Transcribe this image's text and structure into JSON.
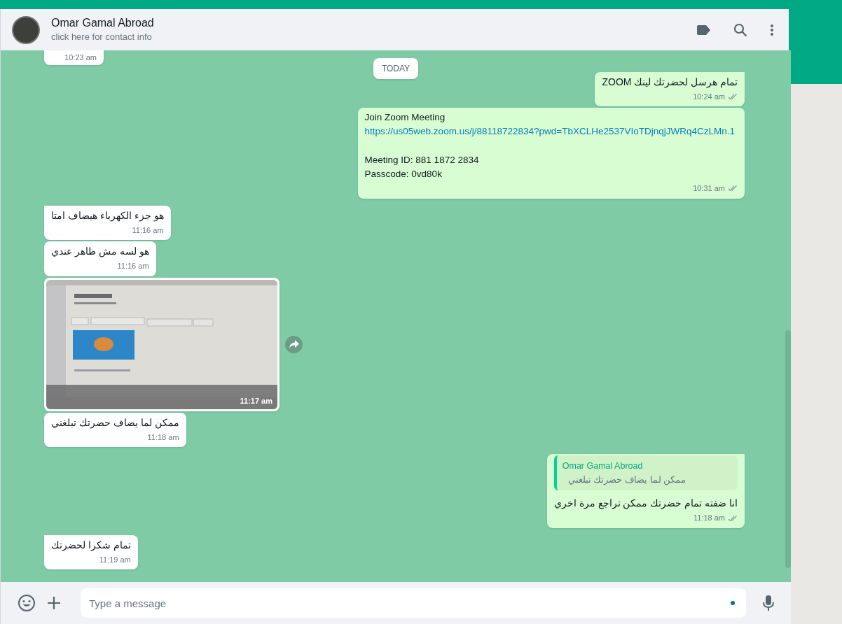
{
  "header": {
    "name": "Omar Gamal Abroad",
    "subtitle": "click here for contact info"
  },
  "date_chip": "TODAY",
  "messages": [
    {
      "kind": "cut",
      "outgoing": false,
      "time": "10:23 am",
      "tail": false
    },
    {
      "kind": "text",
      "outgoing": true,
      "text": "تمام هرسل لحضرتك لينك ZOOM",
      "time": "10:24 am",
      "tail": true,
      "read": false
    },
    {
      "kind": "blocks",
      "outgoing": true,
      "blocks": [
        [
          {
            "text": "Join Zoom Meeting",
            "link": false
          },
          {
            "text": "https://us05web.zoom.us/j/88118722834?pwd=TbXCLHe2537VIoTDjnqjJWRq4CzLMn.1",
            "link": true
          }
        ],
        [
          {
            "text": "Meeting ID: 881 1872 2834",
            "link": false
          },
          {
            "text": "Passcode: 0vd80k",
            "link": false
          }
        ]
      ],
      "time": "10:31 am",
      "tail": false,
      "read": false
    },
    {
      "kind": "text",
      "outgoing": false,
      "text": "هو جزء الكهرباء هيضاف امتا",
      "time": "11:16 am",
      "tail": true
    },
    {
      "kind": "text",
      "outgoing": false,
      "text": "هو لسه مش ظاهر عندي",
      "time": "11:16 am",
      "tail": false
    },
    {
      "outgoing": false,
      "time": "11:17 am",
      "tail": false
    },
    {
      "kind": "text",
      "outgoing": false,
      "text": "ممكن لما يضاف حضرتك تبلغني",
      "time": "11:18 am",
      "tail": false
    },
    {
      "kind": "reply",
      "outgoing": true,
      "quote_author": "Omar Gamal Abroad",
      "quote_text": "ممكن لما يضاف حضرتك تبلغني",
      "text": "انا ضفته تمام حضرتك ممكن تراجع مرة اخري",
      "time": "11:18 am",
      "tail": true,
      "read": false
    },
    {
      "kind": "text",
      "outgoing": false,
      "text": "تمام شكرا لحضرتك",
      "time": "11:19 am",
      "tail": true
    }
  ],
  "composer": {
    "placeholder": "Type a message"
  }
}
